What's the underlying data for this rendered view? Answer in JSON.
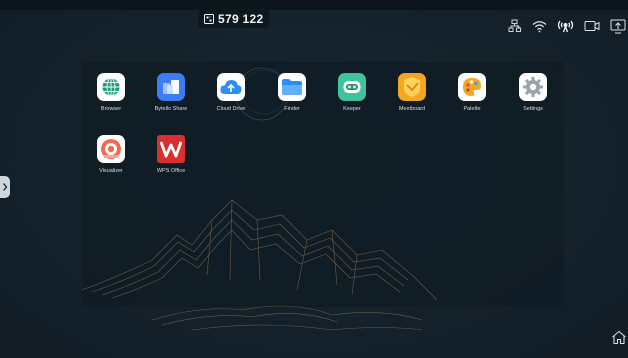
{
  "topbar": {
    "meeting_code": "579 122",
    "code_icon": "qr-code-icon"
  },
  "status_icons": [
    {
      "name": "network-disconnected-icon"
    },
    {
      "name": "wifi-icon"
    },
    {
      "name": "hotspot-icon"
    },
    {
      "name": "screen-record-icon"
    },
    {
      "name": "screen-share-icon"
    }
  ],
  "apps": [
    {
      "name": "browser",
      "label": "Browser",
      "icon": "globe-icon",
      "color": "#ffffff",
      "accent": "#1aa079"
    },
    {
      "name": "bytello-share",
      "label": "Bytello Share",
      "icon": "folder-share-icon",
      "color": "#3d7df4",
      "accent": "#ffffff"
    },
    {
      "name": "cloud-drive",
      "label": "Cloud Drive",
      "icon": "cloud-upload-icon",
      "color": "#ffffff",
      "accent": "#2b8ef0"
    },
    {
      "name": "finder",
      "label": "Finder",
      "icon": "folder-icon",
      "color": "#ffffff",
      "accent": "#2b8ef0"
    },
    {
      "name": "keeper",
      "label": "Keeper",
      "icon": "robot-face-icon",
      "color": "#3ec39c",
      "accent": "#ffffff"
    },
    {
      "name": "meetboard",
      "label": "Meetboard",
      "icon": "board-icon",
      "color": "#f5a623",
      "accent": "#ffd35c"
    },
    {
      "name": "palette",
      "label": "Palette",
      "icon": "palette-icon",
      "color": "#ffffff",
      "accent": "#f6a623"
    },
    {
      "name": "settings",
      "label": "Settings",
      "icon": "gear-icon",
      "color": "#ffffff",
      "accent": "#9aa3aa"
    },
    {
      "name": "visualizer",
      "label": "Visualizer",
      "icon": "camera-lens-icon",
      "color": "#ffffff",
      "accent": "#f26b4f"
    },
    {
      "name": "wps-office",
      "label": "WPS Office",
      "icon": "wps-logo-icon",
      "color": "#d8302f",
      "accent": "#ffffff"
    }
  ],
  "side_handle": {
    "icon": "chevron-right-icon"
  },
  "home": {
    "icon": "home-icon"
  }
}
